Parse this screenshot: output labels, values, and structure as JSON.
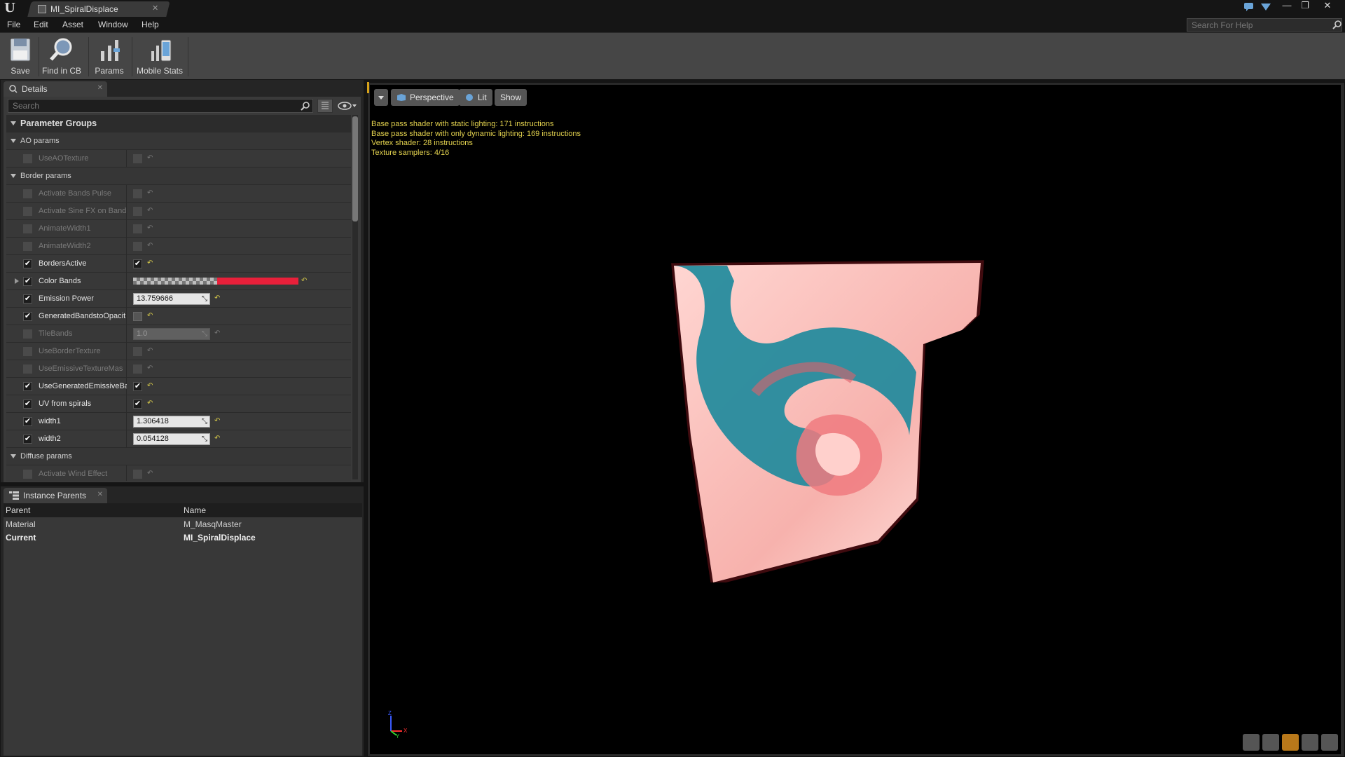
{
  "window": {
    "tab_title": "MI_SpiralDisplace",
    "controls": [
      "—",
      "❐",
      "✕"
    ]
  },
  "menu": {
    "items": [
      "File",
      "Edit",
      "Asset",
      "Window",
      "Help"
    ],
    "help_search_placeholder": "Search For Help"
  },
  "toolbar": {
    "buttons": [
      {
        "label": "Save",
        "icon": "save-icon"
      },
      {
        "label": "Find in CB",
        "icon": "magnifier-icon"
      },
      {
        "label": "Params",
        "icon": "params-icon"
      },
      {
        "label": "Mobile Stats",
        "icon": "mobile-stats-icon"
      }
    ]
  },
  "details": {
    "tab_label": "Details",
    "search_placeholder": "Search",
    "parameter_groups_label": "Parameter Groups",
    "groups": {
      "ao": {
        "label": "AO params",
        "params": [
          {
            "name": "UseAOTexture",
            "enabled": false,
            "value_checked": false
          }
        ]
      },
      "border": {
        "label": "Border params",
        "params": [
          {
            "name": "Activate Bands Pulse",
            "enabled": false,
            "value_checked": false
          },
          {
            "name": "Activate Sine FX on Band",
            "enabled": false,
            "value_checked": false
          },
          {
            "name": "AnimateWidth1",
            "enabled": false,
            "value_checked": false
          },
          {
            "name": "AnimateWidth2",
            "enabled": false,
            "value_checked": false
          },
          {
            "name": "BordersActive",
            "enabled": true,
            "value_checked": true
          },
          {
            "name": "Color Bands",
            "enabled": true,
            "color": "#e8203a"
          },
          {
            "name": "Emission Power",
            "enabled": true,
            "value": "13.759666"
          },
          {
            "name": "GeneratedBandstoOpacit",
            "enabled": true,
            "value_checked": false
          },
          {
            "name": "TileBands",
            "enabled": false,
            "value": "1.0"
          },
          {
            "name": "UseBorderTexture",
            "enabled": false,
            "value_checked": false
          },
          {
            "name": "UseEmissiveTextureMas",
            "enabled": false,
            "value_checked": false
          },
          {
            "name": "UseGeneratedEmissiveBa",
            "enabled": true,
            "value_checked": true
          },
          {
            "name": "UV from spirals",
            "enabled": true,
            "value_checked": true
          },
          {
            "name": "width1",
            "enabled": true,
            "value": "1.306418"
          },
          {
            "name": "width2",
            "enabled": true,
            "value": "0.054128"
          }
        ]
      },
      "diffuse": {
        "label": "Diffuse params",
        "params": [
          {
            "name": "Activate Wind Effect",
            "enabled": false,
            "value_checked": false
          }
        ]
      }
    }
  },
  "instance_parents": {
    "tab_label": "Instance Parents",
    "columns": [
      "Parent",
      "Name"
    ],
    "rows": [
      {
        "parent": "Material",
        "name": "M_MasqMaster"
      },
      {
        "parent": "Current",
        "name": "MI_SpiralDisplace"
      }
    ]
  },
  "viewport": {
    "buttons": [
      "Perspective",
      "Lit",
      "Show"
    ],
    "stats": [
      "Base pass shader with static lighting: 171 instructions",
      "Base pass shader with only dynamic lighting: 169 instructions",
      "Vertex shader: 28 instructions",
      "Texture samplers: 4/16"
    ],
    "axis_labels": [
      "Z",
      "X",
      "Y"
    ]
  },
  "colors": {
    "stats_text": "#e4d34f",
    "reset_arrow": "#d6c94a",
    "band_color": "#e8203a",
    "mesh_pink": "#f6b8b5",
    "mesh_teal": "#1f8a9c"
  }
}
